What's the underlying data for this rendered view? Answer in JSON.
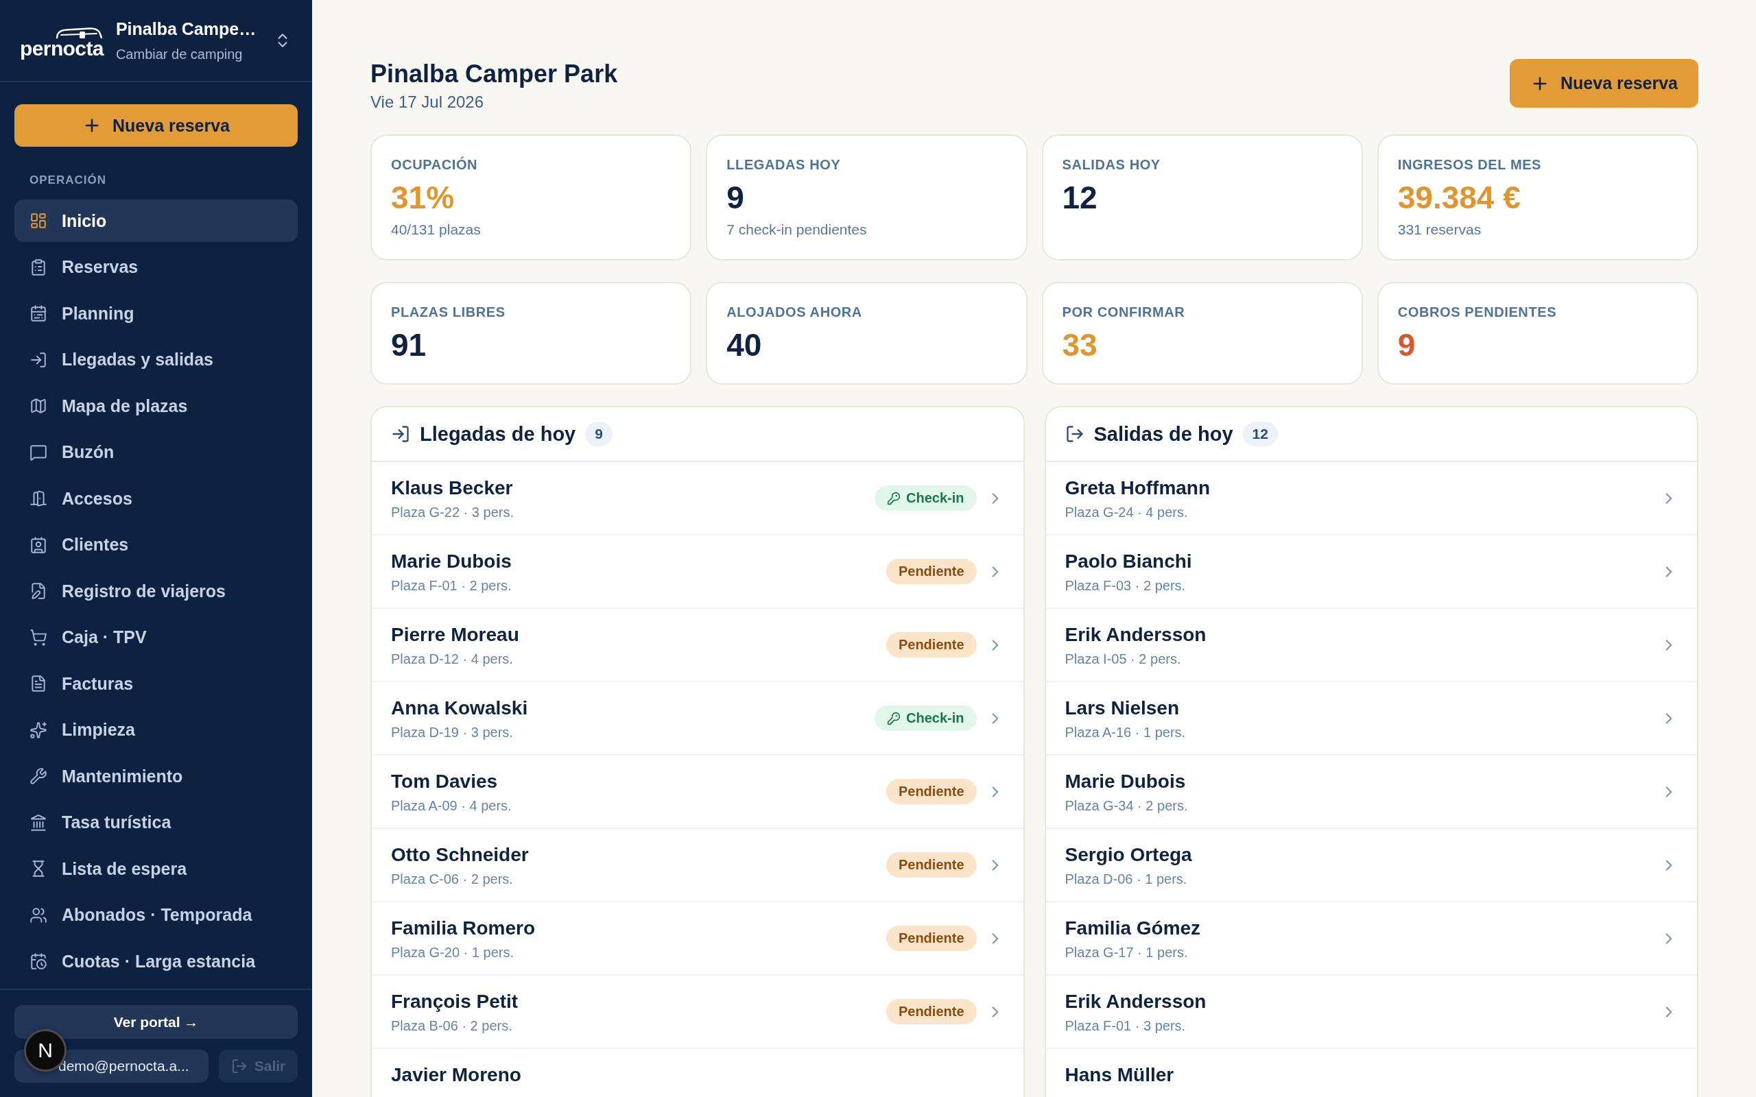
{
  "sidebar": {
    "brand": {
      "wordmark": "pernocta"
    },
    "camping_switcher": {
      "name": "Pinalba Campe…",
      "subtitle": "Cambiar de camping"
    },
    "new_booking_button": {
      "label": "Nueva reserva"
    },
    "section_label": "OPERACIÓN",
    "items": [
      {
        "label": "Inicio",
        "selected": true
      },
      {
        "label": "Reservas",
        "selected": false
      },
      {
        "label": "Planning",
        "selected": false
      },
      {
        "label": "Llegadas y salidas",
        "selected": false
      },
      {
        "label": "Mapa de plazas",
        "selected": false
      },
      {
        "label": "Buzón",
        "selected": false
      },
      {
        "label": "Accesos",
        "selected": false
      },
      {
        "label": "Clientes",
        "selected": false
      },
      {
        "label": "Registro de viajeros",
        "selected": false
      },
      {
        "label": "Caja · TPV",
        "selected": false
      },
      {
        "label": "Facturas",
        "selected": false
      },
      {
        "label": "Limpieza",
        "selected": false
      },
      {
        "label": "Mantenimiento",
        "selected": false
      },
      {
        "label": "Tasa turística",
        "selected": false
      },
      {
        "label": "Lista de espera",
        "selected": false
      },
      {
        "label": "Abonados · Temporada",
        "selected": false
      },
      {
        "label": "Cuotas · Larga estancia",
        "selected": false
      }
    ],
    "portal_button": {
      "label": "Ver portal →"
    },
    "user_button": {
      "label": "demo@pernocta.a..."
    },
    "logout_button": {
      "label": "Salir",
      "disabled": true
    }
  },
  "dev_indicator": {
    "label": "N"
  },
  "header": {
    "title": "Pinalba Camper Park",
    "date": "Vie 17 Jul 2026",
    "new_booking_button": {
      "label": "Nueva reserva"
    }
  },
  "stats": [
    {
      "label": "OCUPACIÓN",
      "value": "31%",
      "sub": "40/131 plazas",
      "color": "#e0962f"
    },
    {
      "label": "LLEGADAS HOY",
      "value": "9",
      "sub": "7 check-in pendientes",
      "color": "#0f2340"
    },
    {
      "label": "SALIDAS HOY",
      "value": "12",
      "color": "#0f2340"
    },
    {
      "label": "INGRESOS DEL MES",
      "value": "39.384 €",
      "sub": "331 reservas",
      "color": "#e0962f"
    },
    {
      "label": "PLAZAS LIBRES",
      "value": "91",
      "color": "#0f2340"
    },
    {
      "label": "ALOJADOS AHORA",
      "value": "40",
      "color": "#0f2340"
    },
    {
      "label": "POR CONFIRMAR",
      "value": "33",
      "color": "#e0962f"
    },
    {
      "label": "COBROS PENDIENTES",
      "value": "9",
      "color": "#d9582b"
    }
  ],
  "panels": [
    {
      "kind": "arrivals",
      "title": "Llegadas de hoy",
      "count": "9",
      "rows": [
        {
          "name": "Klaus Becker",
          "detail": "Plaza G-22 · 3 pers.",
          "status": {
            "kind": "checkin",
            "label": "Check-in"
          }
        },
        {
          "name": "Marie Dubois",
          "detail": "Plaza F-01 · 2 pers.",
          "status": {
            "kind": "pending",
            "label": "Pendiente"
          }
        },
        {
          "name": "Pierre Moreau",
          "detail": "Plaza D-12 · 4 pers.",
          "status": {
            "kind": "pending",
            "label": "Pendiente"
          }
        },
        {
          "name": "Anna Kowalski",
          "detail": "Plaza D-19 · 3 pers.",
          "status": {
            "kind": "checkin",
            "label": "Check-in"
          }
        },
        {
          "name": "Tom Davies",
          "detail": "Plaza A-09 · 4 pers.",
          "status": {
            "kind": "pending",
            "label": "Pendiente"
          }
        },
        {
          "name": "Otto Schneider",
          "detail": "Plaza C-06 · 2 pers.",
          "status": {
            "kind": "pending",
            "label": "Pendiente"
          }
        },
        {
          "name": "Familia Romero",
          "detail": "Plaza G-20 · 1 pers.",
          "status": {
            "kind": "pending",
            "label": "Pendiente"
          }
        },
        {
          "name": "François Petit",
          "detail": "Plaza B-06 · 2 pers.",
          "status": {
            "kind": "pending",
            "label": "Pendiente"
          }
        },
        {
          "name": "Javier Moreno"
        }
      ]
    },
    {
      "kind": "departures",
      "title": "Salidas de hoy",
      "count": "12",
      "rows": [
        {
          "name": "Greta Hoffmann",
          "detail": "Plaza G-24 · 4 pers."
        },
        {
          "name": "Paolo Bianchi",
          "detail": "Plaza F-03 · 2 pers."
        },
        {
          "name": "Erik Andersson",
          "detail": "Plaza I-05 · 2 pers."
        },
        {
          "name": "Lars Nielsen",
          "detail": "Plaza A-16 · 1 pers."
        },
        {
          "name": "Marie Dubois",
          "detail": "Plaza G-34 · 2 pers."
        },
        {
          "name": "Sergio Ortega",
          "detail": "Plaza D-06 · 1 pers."
        },
        {
          "name": "Familia Gómez",
          "detail": "Plaza G-17 · 1 pers."
        },
        {
          "name": "Erik Andersson",
          "detail": "Plaza F-01 · 3 pers."
        },
        {
          "name": "Hans Müller"
        }
      ]
    }
  ]
}
